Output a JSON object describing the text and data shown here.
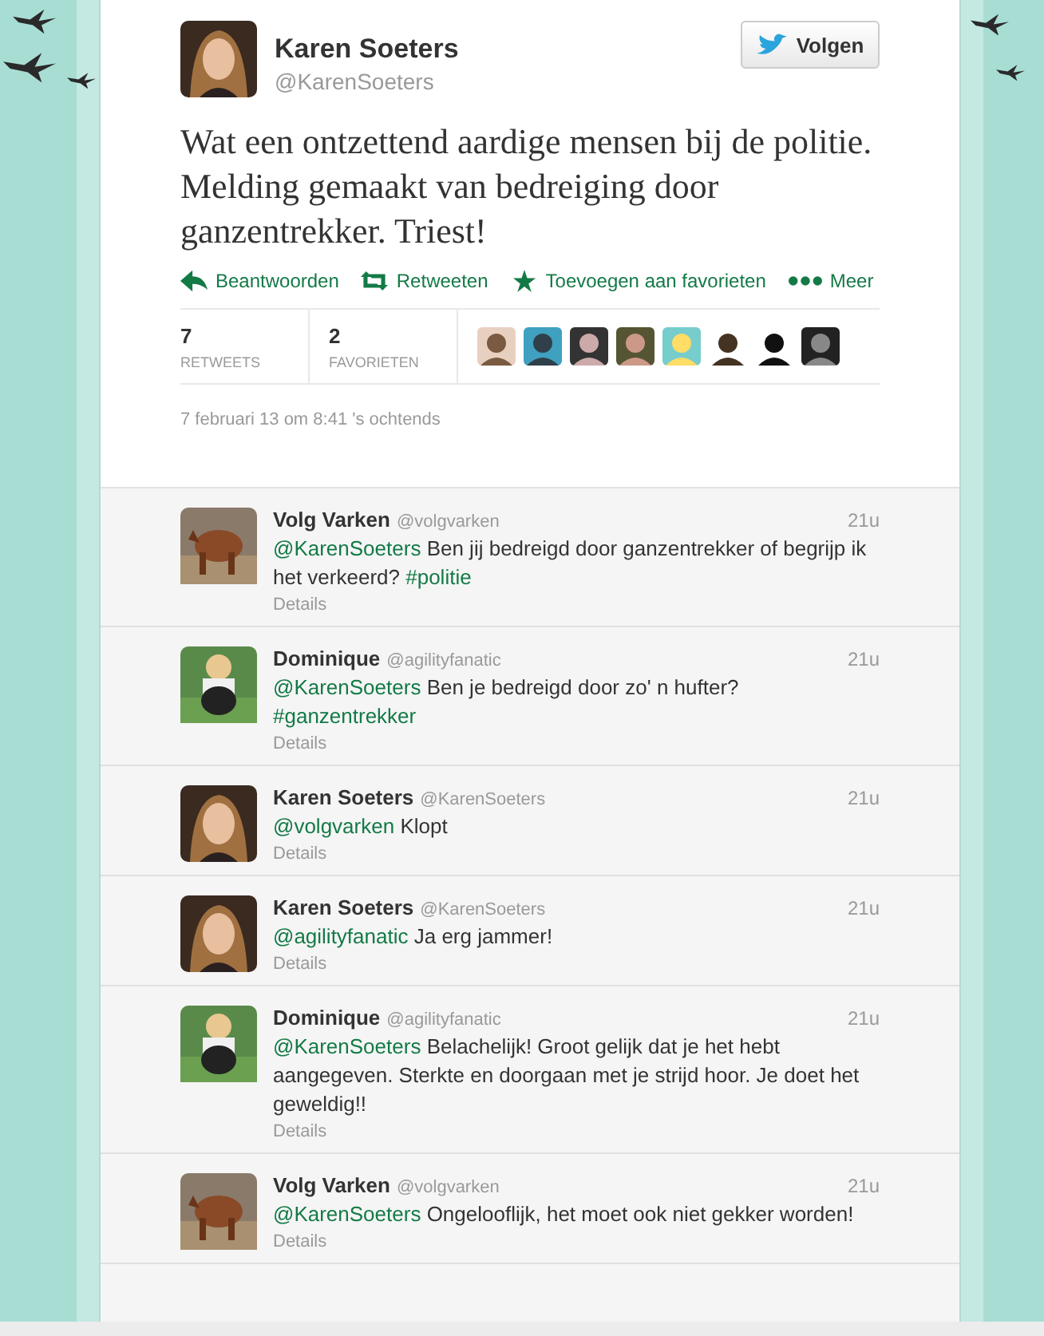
{
  "tweet": {
    "name": "Karen Soeters",
    "handle": "@KarenSoeters",
    "follow_button": "Volgen",
    "text": "Wat een ontzettend aardige mensen bij de politie. Melding gemaakt van bedreiging door ganzentrekker. Triest!",
    "actions": [
      {
        "kind": "reply",
        "label": "Beantwoorden"
      },
      {
        "kind": "retweet",
        "label": "Retweeten"
      },
      {
        "kind": "favorite",
        "label": "Toevoegen aan favorieten"
      },
      {
        "kind": "more",
        "label": "Meer"
      }
    ],
    "stats": [
      {
        "count": "7",
        "label": "RETWEETS"
      },
      {
        "count": "2",
        "label": "FAVORIETEN"
      }
    ],
    "timestamp": "7 februari 13 om 8:41 's ochtends"
  },
  "replies": [
    {
      "name": "Volg Varken",
      "handle": "@volgvarken",
      "time": "21u",
      "details": "Details",
      "segments": [
        {
          "kind": "link",
          "text": "@KarenSoeters"
        },
        {
          "kind": "text",
          "text": " Ben jij bedreigd door ganzentrekker of begrijp ik het verkeerd? "
        },
        {
          "kind": "link",
          "text": "#politie"
        }
      ]
    },
    {
      "name": "Dominique",
      "handle": "@agilityfanatic",
      "time": "21u",
      "details": "Details",
      "segments": [
        {
          "kind": "link",
          "text": "@KarenSoeters"
        },
        {
          "kind": "text",
          "text": " Ben je bedreigd door zo' n hufter? "
        },
        {
          "kind": "link",
          "text": "#ganzentrekker"
        }
      ]
    },
    {
      "name": "Karen Soeters",
      "handle": "@KarenSoeters",
      "time": "21u",
      "details": "Details",
      "segments": [
        {
          "kind": "link",
          "text": "@volgvarken"
        },
        {
          "kind": "text",
          "text": " Klopt"
        }
      ]
    },
    {
      "name": "Karen Soeters",
      "handle": "@KarenSoeters",
      "time": "21u",
      "details": "Details",
      "segments": [
        {
          "kind": "link",
          "text": "@agilityfanatic"
        },
        {
          "kind": "text",
          "text": " Ja erg jammer!"
        }
      ]
    },
    {
      "name": "Dominique",
      "handle": "@agilityfanatic",
      "time": "21u",
      "details": "Details",
      "segments": [
        {
          "kind": "link",
          "text": "@KarenSoeters"
        },
        {
          "kind": "text",
          "text": " Belachelijk! Groot gelijk dat je het hebt aangegeven. Sterkte en doorgaan met je strijd hoor. Je doet het geweldig!!"
        }
      ]
    },
    {
      "name": "Volg Varken",
      "handle": "@volgvarken",
      "time": "21u",
      "details": "Details",
      "segments": [
        {
          "kind": "link",
          "text": "@KarenSoeters"
        },
        {
          "kind": "text",
          "text": " Ongelooflijk, het moet ook niet gekker worden!"
        }
      ]
    }
  ]
}
